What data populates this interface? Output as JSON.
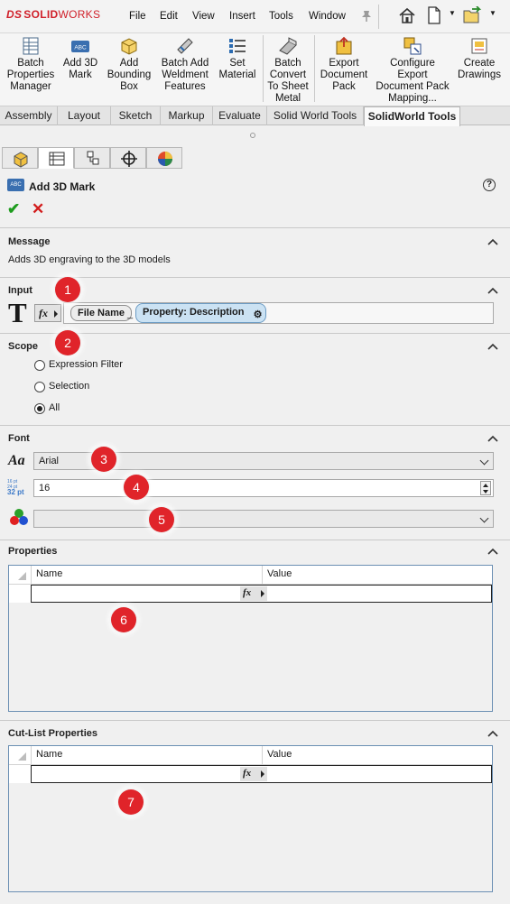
{
  "app": {
    "logo_prefix": "DS",
    "logo_solid": "SOLID",
    "logo_works": "WORKS",
    "menu": [
      "File",
      "Edit",
      "View",
      "Insert",
      "Tools",
      "Window"
    ]
  },
  "ribbon": {
    "commands": [
      {
        "label": "Batch\nProperties\nManager",
        "icon": "properties-table-icon"
      },
      {
        "label": "Add 3D\nMark",
        "icon": "abc-mark-icon"
      },
      {
        "label": "Add\nBounding\nBox",
        "icon": "bounding-box-icon"
      },
      {
        "label": "Batch Add\nWeldment\nFeatures",
        "icon": "weldment-icon"
      },
      {
        "label": "Set\nMaterial",
        "icon": "material-list-icon"
      },
      {
        "label": "Batch\nConvert\nTo Sheet\nMetal",
        "icon": "sheet-metal-icon"
      },
      {
        "label": "Export\nDocument\nPack",
        "icon": "export-pack-icon"
      },
      {
        "label": "Configure\nExport\nDocument Pack\nMapping...",
        "icon": "configure-mapping-icon"
      },
      {
        "label": "Create\nDrawings",
        "icon": "drawing-icon"
      }
    ]
  },
  "tabs": [
    "Assembly",
    "Layout",
    "Sketch",
    "Markup",
    "Evaluate",
    "Solid World Tools",
    "SolidWorld Tools"
  ],
  "active_tab": "SolidWorld Tools",
  "property_manager": {
    "title": "Add 3D Mark",
    "icon_text": "ABC",
    "help_symbol": "?",
    "ok_symbol": "✔",
    "cancel_symbol": "✕"
  },
  "message": {
    "title": "Message",
    "text": "Adds 3D engraving to the 3D models"
  },
  "input": {
    "title": "Input",
    "big_symbol": "T",
    "fx_label": "fx",
    "token_file": "File Name",
    "token_separator": "_",
    "token_property": "Property: Description",
    "gear_symbol": "⚙"
  },
  "scope": {
    "title": "Scope",
    "options": [
      {
        "label": "Expression Filter",
        "selected": false
      },
      {
        "label": "Selection",
        "selected": false
      },
      {
        "label": "All",
        "selected": true
      }
    ]
  },
  "font": {
    "title": "Font",
    "font_icon": "Aa",
    "font_name": "Arial",
    "size_icon_lines": [
      "16 pt",
      "24 pt",
      "32 pt"
    ],
    "size_value": "16",
    "color_value": ""
  },
  "properties": {
    "title": "Properties",
    "col_name": "Name",
    "col_value": "Value",
    "fx_label": "fx"
  },
  "cutlist": {
    "title": "Cut-List Properties",
    "col_name": "Name",
    "col_value": "Value",
    "fx_label": "fx"
  },
  "callouts": [
    "1",
    "2",
    "3",
    "4",
    "5",
    "6",
    "7"
  ],
  "colors": {
    "brand_red": "#d0202a",
    "callout_red": "#e0242a",
    "ok_green": "#1e9c1e",
    "token_blue": "#cbe2f3"
  }
}
